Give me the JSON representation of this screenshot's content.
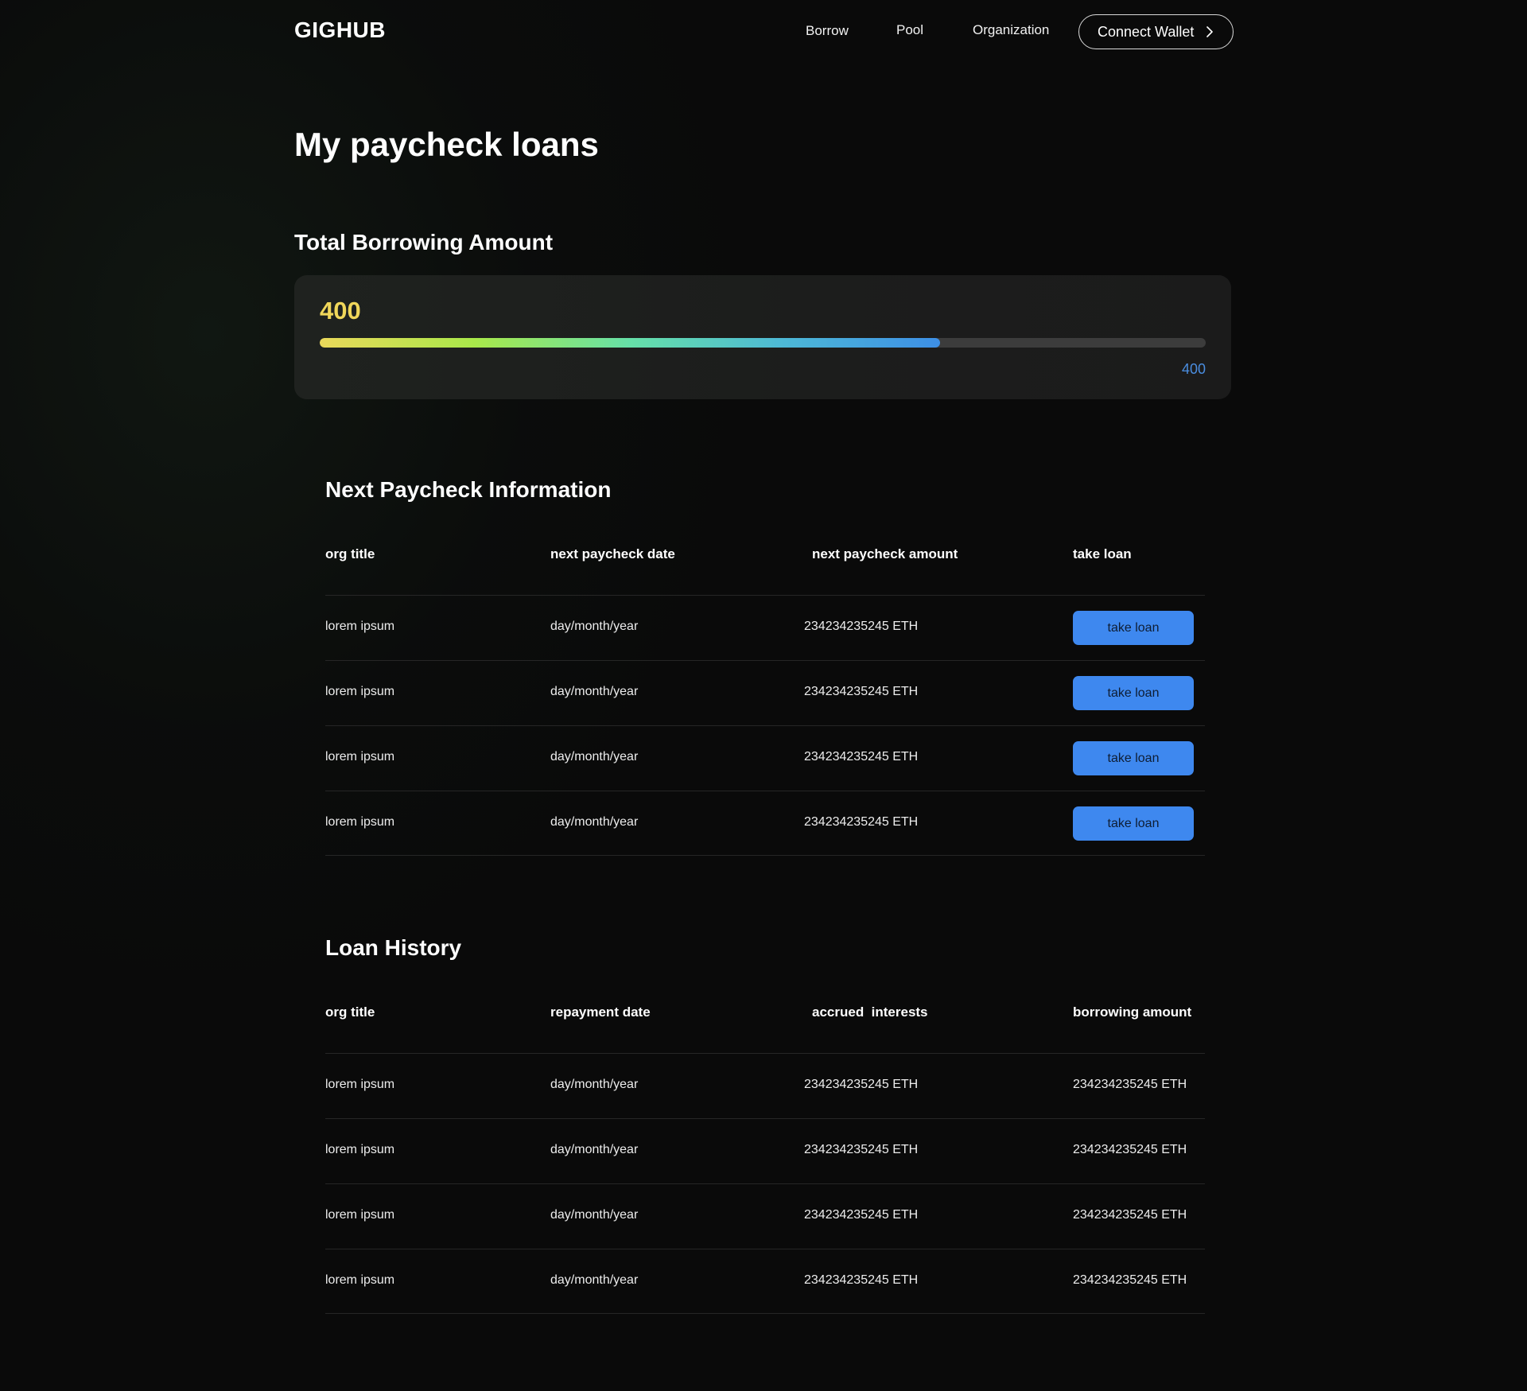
{
  "header": {
    "logo": "GIGHUB",
    "nav": [
      {
        "label": "Borrow"
      },
      {
        "label": "Pool"
      },
      {
        "label": "Organization"
      }
    ],
    "connect_wallet_label": "Connect Wallet",
    "connect_wallet_icon": "chevron-right-icon"
  },
  "page": {
    "title": "My paycheck loans"
  },
  "total_borrowing": {
    "title": "Total Borrowing Amount",
    "amount": "400",
    "max_label": "400",
    "progress_fraction": 0.7,
    "gradient_colors": [
      "#ead85a",
      "#a8e84a",
      "#66e0a8",
      "#4db8d6",
      "#3d8fe6"
    ],
    "amount_color": "#f0d75a",
    "max_color": "#4a8de0"
  },
  "next_paycheck": {
    "title": "Next Paycheck Information",
    "columns": [
      "org title",
      "next paycheck date",
      "next paycheck amount",
      "take loan"
    ],
    "rows": [
      {
        "org": "lorem ipsum",
        "date": "day/month/year",
        "amount": "234234235245 ETH",
        "action": "take loan"
      },
      {
        "org": "lorem ipsum",
        "date": "day/month/year",
        "amount": "234234235245 ETH",
        "action": "take loan"
      },
      {
        "org": "lorem ipsum",
        "date": "day/month/year",
        "amount": "234234235245 ETH",
        "action": "take loan"
      },
      {
        "org": "lorem ipsum",
        "date": "day/month/year",
        "amount": "234234235245 ETH",
        "action": "take loan"
      }
    ],
    "button_color": "#3e88ef"
  },
  "loan_history": {
    "title": "Loan History",
    "columns": [
      "org title",
      "repayment date",
      "accrued  interests",
      "borrowing amount"
    ],
    "rows": [
      {
        "org": "lorem ipsum",
        "date": "day/month/year",
        "interest": "234234235245 ETH",
        "amount": "234234235245 ETH"
      },
      {
        "org": "lorem ipsum",
        "date": "day/month/year",
        "interest": "234234235245 ETH",
        "amount": "234234235245 ETH"
      },
      {
        "org": "lorem ipsum",
        "date": "day/month/year",
        "interest": "234234235245 ETH",
        "amount": "234234235245 ETH"
      },
      {
        "org": "lorem ipsum",
        "date": "day/month/year",
        "interest": "234234235245 ETH",
        "amount": "234234235245 ETH"
      }
    ]
  }
}
